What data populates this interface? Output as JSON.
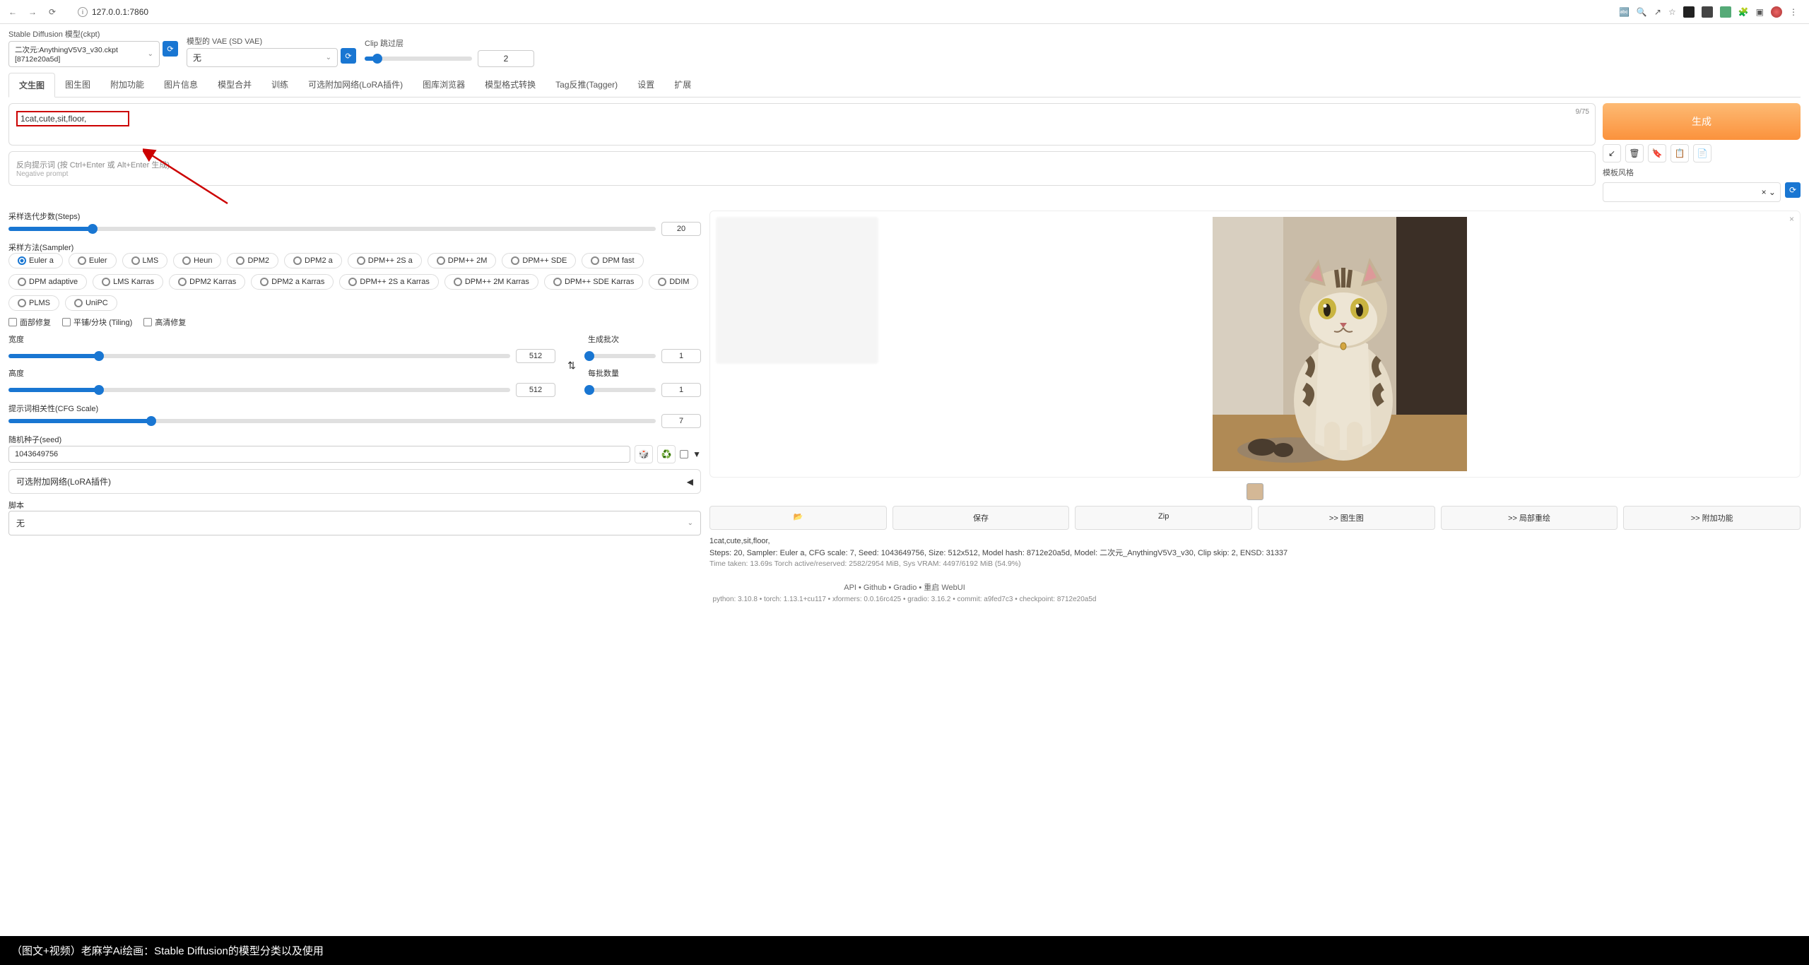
{
  "browser": {
    "url": "127.0.0.1:7860"
  },
  "checkpoint": {
    "label": "Stable Diffusion 模型(ckpt)",
    "value": "二次元:AnythingV5V3_v30.ckpt [8712e20a5d]"
  },
  "vae": {
    "label": "模型的 VAE (SD VAE)",
    "value": "无"
  },
  "clip": {
    "label": "Clip 跳过层",
    "value": "2"
  },
  "tabs": [
    "文生图",
    "图生图",
    "附加功能",
    "图片信息",
    "模型合并",
    "训练",
    "可选附加网络(LoRA插件)",
    "图库浏览器",
    "模型格式转换",
    "Tag反推(Tagger)",
    "设置",
    "扩展"
  ],
  "active_tab": 0,
  "prompt": {
    "text": "1cat,cute,sit,floor,",
    "tokens": "9/75"
  },
  "neg": {
    "label": "反向提示词 (按 Ctrl+Enter 或 Alt+Enter 生成)",
    "sub": "Negative prompt"
  },
  "generate": {
    "label": "生成"
  },
  "style": {
    "label": "模板风格"
  },
  "sampling": {
    "steps_label": "采样迭代步数(Steps)",
    "steps_value": "20",
    "sampler_label": "采样方法(Sampler)",
    "samplers": [
      "Euler a",
      "Euler",
      "LMS",
      "Heun",
      "DPM2",
      "DPM2 a",
      "DPM++ 2S a",
      "DPM++ 2M",
      "DPM++ SDE",
      "DPM fast",
      "DPM adaptive",
      "LMS Karras",
      "DPM2 Karras",
      "DPM2 a Karras",
      "DPM++ 2S a Karras",
      "DPM++ 2M Karras",
      "DPM++ SDE Karras",
      "DDIM",
      "PLMS",
      "UniPC"
    ],
    "sampler_selected": "Euler a"
  },
  "checks": {
    "face": "面部修复",
    "tiling": "平铺/分块 (Tiling)",
    "hires": "高清修复"
  },
  "dims": {
    "width_label": "宽度",
    "height_label": "高度",
    "width": "512",
    "height": "512",
    "batch_count_label": "生成批次",
    "batch_count": "1",
    "batch_size_label": "每批数量",
    "batch_size": "1"
  },
  "cfg": {
    "label": "提示词相关性(CFG Scale)",
    "value": "7"
  },
  "seed": {
    "label": "随机种子(seed)",
    "value": "1043649756"
  },
  "extra_networks": {
    "label": "可选附加网络(LoRA插件)"
  },
  "script": {
    "label": "脚本",
    "value": "无"
  },
  "output": {
    "btn_folder": "📂",
    "btn_save": "保存",
    "btn_zip": "Zip",
    "btn_i2i": ">> 图生图",
    "btn_inpaint": ">> 局部重绘",
    "btn_extras": ">> 附加功能",
    "prompt_echo": "1cat,cute,sit,floor,",
    "params": "Steps: 20, Sampler: Euler a, CFG scale: 7, Seed: 1043649756, Size: 512x512, Model hash: 8712e20a5d, Model: 二次元_AnythingV5V3_v30, Clip skip: 2, ENSD: 31337",
    "time": "Time taken: 13.69s Torch active/reserved: 2582/2954 MiB, Sys VRAM: 4497/6192 MiB (54.9%)"
  },
  "footer": {
    "links": "API • Github • Gradio • 重启 WebUI",
    "version": "python: 3.10.8  •  torch: 1.13.1+cu117  •  xformers: 0.0.16rc425  •  gradio: 3.16.2  •  commit: a9fed7c3  •  checkpoint: 8712e20a5d"
  },
  "caption": "（图文+视频）老麻学Ai绘画：Stable Diffusion的模型分类以及使用"
}
